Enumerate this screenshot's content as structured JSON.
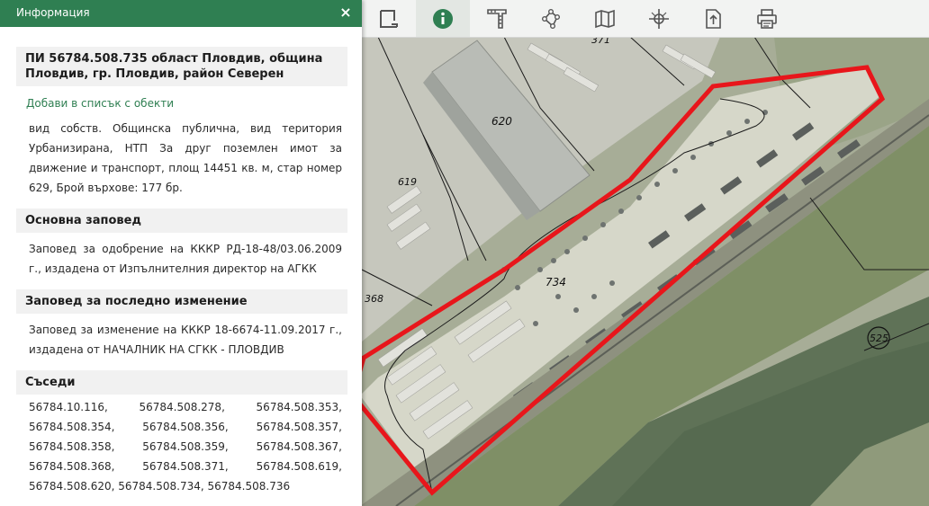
{
  "panel": {
    "title": "Информация",
    "close_symbol": "×",
    "property_title": "ПИ 56784.508.735 област Пловдив, община Пловдив, гр. Пловдив, район Северен",
    "add_to_list": "Добави в списък с обекти",
    "description": "вид собств. Общинска публична, вид територия Урбанизирана, НТП За друг поземлен имот за движение и транспорт, площ 14451 кв. м, стар номер 629, Брой върхове: 177 бр.",
    "main_order": {
      "heading": "Основна заповед",
      "text": "Заповед за одобрение на КККР РД-18-48/03.06.2009 г., издадена от Изпълнителния директор на АГКК"
    },
    "last_change": {
      "heading": "Заповед за последно изменение",
      "text": "Заповед за изменение на КККР 18-6674-11.09.2017 г., издадена от НАЧАЛНИК НА СГКК - ПЛОВДИВ"
    },
    "neighbors": {
      "heading": "Съседи",
      "items": [
        "56784.10.116,",
        "56784.508.278,",
        "56784.508.353,",
        "56784.508.354,",
        "56784.508.356,",
        "56784.508.357,",
        "56784.508.358,",
        "56784.508.359,",
        "56784.508.367,",
        "56784.508.368,",
        "56784.508.371,",
        "56784.508.619,",
        "56784.508.620, 56784.508.734, 56784.508.736"
      ]
    }
  },
  "toolbar": {
    "tools": [
      {
        "icon": "select-rectangle-icon"
      },
      {
        "icon": "info-icon",
        "active": true
      },
      {
        "icon": "measure-ruler-icon"
      },
      {
        "icon": "polygon-nodes-icon"
      },
      {
        "icon": "map-layers-icon"
      },
      {
        "icon": "crosshair-coordinates-icon"
      },
      {
        "icon": "export-upload-icon"
      },
      {
        "icon": "print-icon"
      }
    ]
  },
  "map": {
    "parcel_labels": [
      "371",
      "620",
      "619",
      "734",
      "368",
      "525"
    ],
    "highlight_color": "#e8161b",
    "accent_color": "#2f7f52"
  }
}
